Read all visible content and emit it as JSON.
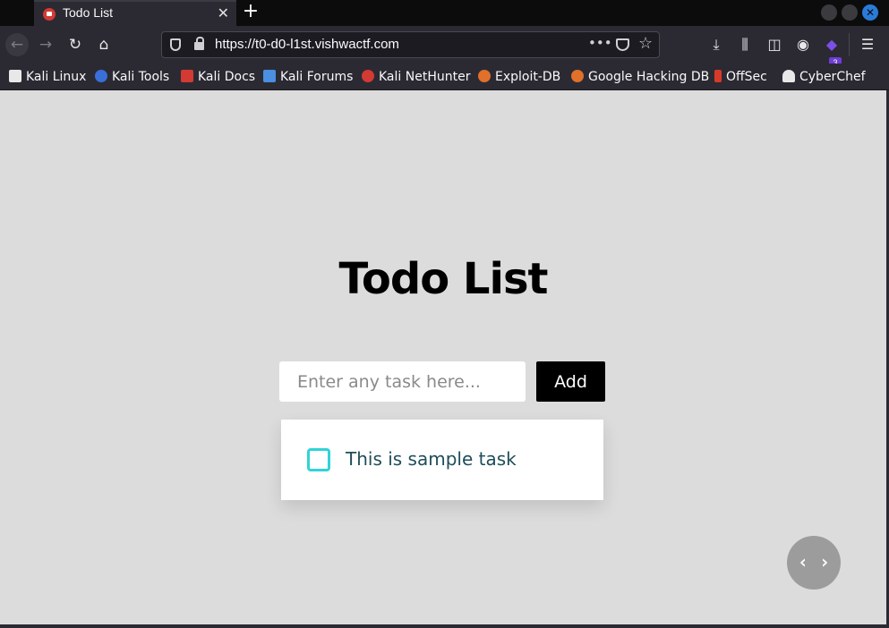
{
  "browser": {
    "tab": {
      "title": "Todo List"
    },
    "url": "https://t0-d0-l1st.vishwactf.com",
    "extension_badge": "3",
    "bookmarks": [
      {
        "label": "Kali Linux",
        "color": "#e8e8e8"
      },
      {
        "label": "Kali Tools",
        "color": "#3a6fd8"
      },
      {
        "label": "Kali Docs",
        "color": "#d23a33"
      },
      {
        "label": "Kali Forums",
        "color": "#4a8fe0"
      },
      {
        "label": "Kali NetHunter",
        "color": "#d23a33"
      },
      {
        "label": "Exploit-DB",
        "color": "#e0702a"
      },
      {
        "label": "Google Hacking DB",
        "color": "#e0702a"
      },
      {
        "label": "OffSec",
        "color": "#d83a2a"
      },
      {
        "label": "CyberChef",
        "color": "#e8e8e8"
      }
    ]
  },
  "app": {
    "title": "Todo List",
    "input_placeholder": "Enter any task here...",
    "add_label": "Add",
    "tasks": [
      {
        "text": "This is sample task",
        "done": false
      }
    ],
    "fab_label": "‹ ›"
  }
}
